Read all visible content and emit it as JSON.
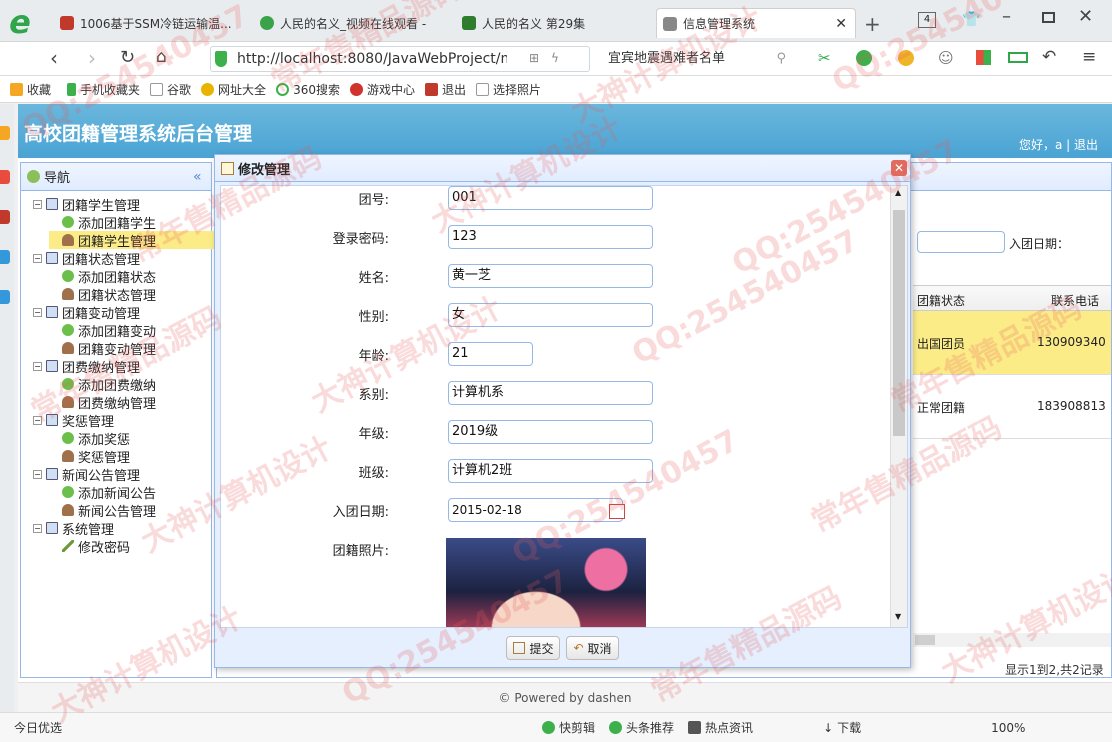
{
  "browser": {
    "tabs": [
      {
        "title": "1006基于SSM冷链运输温...",
        "color": "#c0392b"
      },
      {
        "title": "人民的名义_视频在线观看 -",
        "color": "#3aa34a"
      },
      {
        "title": "人民的名义 第29集",
        "color": "#2d7d2d"
      },
      {
        "title": "信息管理系统",
        "color": "#777777"
      }
    ],
    "tab_count": "4",
    "url": "http://localhost:8080/JavaWebProject/m",
    "search_text": "宜宾地震遇难者名单"
  },
  "bookmarks": [
    "收藏",
    "手机收藏夹",
    "谷歌",
    "网址大全",
    "360搜索",
    "游戏中心",
    "退出",
    "选择照片"
  ],
  "app": {
    "title": "高校团籍管理系统后台管理",
    "welcome": "您好，a | 退出",
    "nav_title": "导航",
    "footer": "© Powered by dashen"
  },
  "tree": [
    {
      "label": "团籍学生管理",
      "level": 0
    },
    {
      "label": "添加团籍学生",
      "level": 1
    },
    {
      "label": "团籍学生管理",
      "level": 1,
      "selected": true
    },
    {
      "label": "团籍状态管理",
      "level": 0
    },
    {
      "label": "添加团籍状态",
      "level": 1
    },
    {
      "label": "团籍状态管理",
      "level": 1
    },
    {
      "label": "团籍变动管理",
      "level": 0
    },
    {
      "label": "添加团籍变动",
      "level": 1
    },
    {
      "label": "团籍变动管理",
      "level": 1
    },
    {
      "label": "团费缴纳管理",
      "level": 0
    },
    {
      "label": "添加团费缴纳",
      "level": 1
    },
    {
      "label": "团费缴纳管理",
      "level": 1
    },
    {
      "label": "奖惩管理",
      "level": 0
    },
    {
      "label": "添加奖惩",
      "level": 1
    },
    {
      "label": "奖惩管理",
      "level": 1
    },
    {
      "label": "新闻公告管理",
      "level": 0
    },
    {
      "label": "添加新闻公告",
      "level": 1
    },
    {
      "label": "新闻公告管理",
      "level": 1
    },
    {
      "label": "系统管理",
      "level": 0
    },
    {
      "label": "修改密码",
      "level": 1
    }
  ],
  "grid": {
    "search_label": "入团日期：",
    "headers": [
      "团籍状态",
      "联系电话"
    ],
    "rows": [
      [
        "出国团员",
        "130909340"
      ],
      [
        "正常团籍",
        "183908813"
      ]
    ],
    "pager": "显示1到2,共2记录"
  },
  "dialog": {
    "title": "修改管理",
    "fields": [
      {
        "label": "团号:",
        "value": "001"
      },
      {
        "label": "登录密码:",
        "value": "123"
      },
      {
        "label": "姓名:",
        "value": "黄一芝"
      },
      {
        "label": "性别:",
        "value": "女"
      },
      {
        "label": "年龄:",
        "value": "21"
      },
      {
        "label": "系别:",
        "value": "计算机系"
      },
      {
        "label": "年级:",
        "value": "2019级"
      },
      {
        "label": "班级:",
        "value": "计算机2班"
      },
      {
        "label": "入团日期:",
        "value": "2015-02-18"
      },
      {
        "label": "团籍照片:",
        "value": ""
      }
    ],
    "submit": "提交",
    "cancel": "取消"
  },
  "statusbar": [
    "今日优选",
    "快剪辑",
    "头条推荐",
    "热点资讯",
    "下载",
    "100%"
  ],
  "watermarks": [
    "QQ:254540457",
    "常年售精品源码",
    "大神计算机设计"
  ],
  "colors": {
    "header": "#4aa3d3",
    "panel_border": "#95b8e7",
    "selected_row": "#fbec88"
  }
}
